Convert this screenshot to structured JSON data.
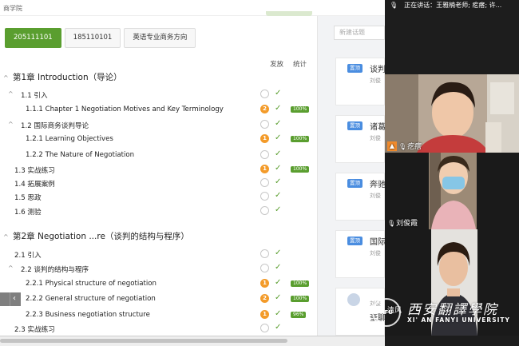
{
  "topbar": {
    "brand": "商学院"
  },
  "tabs": [
    "205111101",
    "185110101",
    "英语专业商务方向"
  ],
  "headers": {
    "publish": "发放",
    "stats": "统计"
  },
  "chapters": [
    {
      "caret": "^",
      "title": "第1章 Introduction（导论）"
    },
    {
      "caret": "^",
      "title": "第2章 Negotiation ...re（谈判的结构与程序）"
    }
  ],
  "rows": [
    {
      "caret": "^",
      "label": "1.1  引入",
      "count": "",
      "pct": ""
    },
    {
      "caret": "",
      "label": "1.1.1 Chapter 1 Negotiation Motives and Key Terminology",
      "count": "2",
      "pct": "100%"
    },
    {
      "caret": "^",
      "label": "1.2  国际商务谈判导论",
      "count": "",
      "pct": ""
    },
    {
      "caret": "",
      "label": "1.2.1 Learning Objectives",
      "count": "1",
      "pct": "100%"
    },
    {
      "caret": "",
      "label": "1.2.2 The Nature of Negotiation",
      "count": "",
      "pct": ""
    },
    {
      "caret": "",
      "label": "1.3  实战练习",
      "count": "1",
      "pct": "100%"
    },
    {
      "caret": "",
      "label": "1.4  拓展案例",
      "count": "",
      "pct": ""
    },
    {
      "caret": "",
      "label": "1.5  思政",
      "count": "",
      "pct": ""
    },
    {
      "caret": "",
      "label": "1.6  测验",
      "count": "",
      "pct": ""
    },
    {
      "caret": "",
      "label": "2.1  引入",
      "count": "",
      "pct": ""
    },
    {
      "caret": "^",
      "label": "2.2  谈判的结构与程序",
      "count": "",
      "pct": ""
    },
    {
      "caret": "",
      "label": "2.2.1 Physical structure of negotiation",
      "count": "1",
      "pct": "100%"
    },
    {
      "caret": "",
      "label": "2.2.2 General structure of negotiation",
      "count": "2",
      "pct": "100%"
    },
    {
      "caret": "",
      "label": "2.2.3 Business negotiation structure",
      "count": "1",
      "pct": "96%"
    },
    {
      "caret": "",
      "label": "2.3  实战练习",
      "count": "",
      "pct": ""
    }
  ],
  "side": {
    "search_placeholder": "新建话题",
    "pin_label": "置顶",
    "cards": [
      {
        "title": "谈判",
        "author": "刘俊"
      },
      {
        "title": "诸葛",
        "author": "刘俊"
      },
      {
        "title": "奔驰",
        "author": "刘俊"
      },
      {
        "title": "国际",
        "author": "刘俊"
      },
      {
        "title": "奎聊",
        "author": "刘俊"
      }
    ]
  },
  "prev_arrow": "‹",
  "conference": {
    "speaking": "正在讲话：王雅楠老师; 疙瘩; 许...",
    "participants": [
      {
        "name": "疙瘩"
      },
      {
        "name": "刘俊霞"
      },
      {
        "name": "清风"
      }
    ]
  },
  "watermark": {
    "logo": "XFU",
    "cn": "西安翻譯學院",
    "en": "XI' AN FANYI UNIVERSITY"
  },
  "colors": {
    "accent_green": "#5a9e2f",
    "badge_orange": "#f39b2a",
    "pin_blue": "#4a8de0"
  }
}
